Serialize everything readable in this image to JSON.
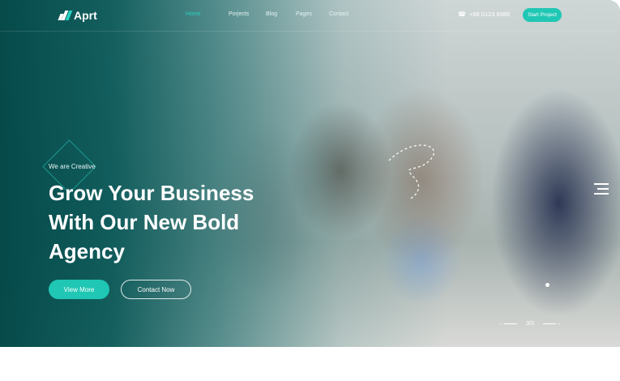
{
  "brand": {
    "name": "Aprt"
  },
  "nav": {
    "items": [
      {
        "label": "Home",
        "active": true
      },
      {
        "label": "Porjects",
        "active": false
      },
      {
        "label": "Blog",
        "active": false
      },
      {
        "label": "Pages",
        "active": false
      },
      {
        "label": "Contact",
        "active": false
      }
    ],
    "phone": "+88 0123 6985",
    "cta_label": "Start Project"
  },
  "hero": {
    "eyebrow": "We are Creative",
    "headline_lines": [
      "Grow Your Business",
      "With Our New Bold",
      "Agency"
    ],
    "primary_button": "View More",
    "secondary_button": "Contact Now"
  },
  "slider": {
    "counter": "3/3"
  },
  "colors": {
    "accent": "#1fc7b4",
    "overlay": "#005252",
    "text": "#ffffff"
  },
  "icons": {
    "logo": "aprt-logo-icon",
    "phone": "phone-icon",
    "menu": "hamburger-icon",
    "prev": "arrow-left-icon",
    "next": "arrow-right-icon"
  }
}
